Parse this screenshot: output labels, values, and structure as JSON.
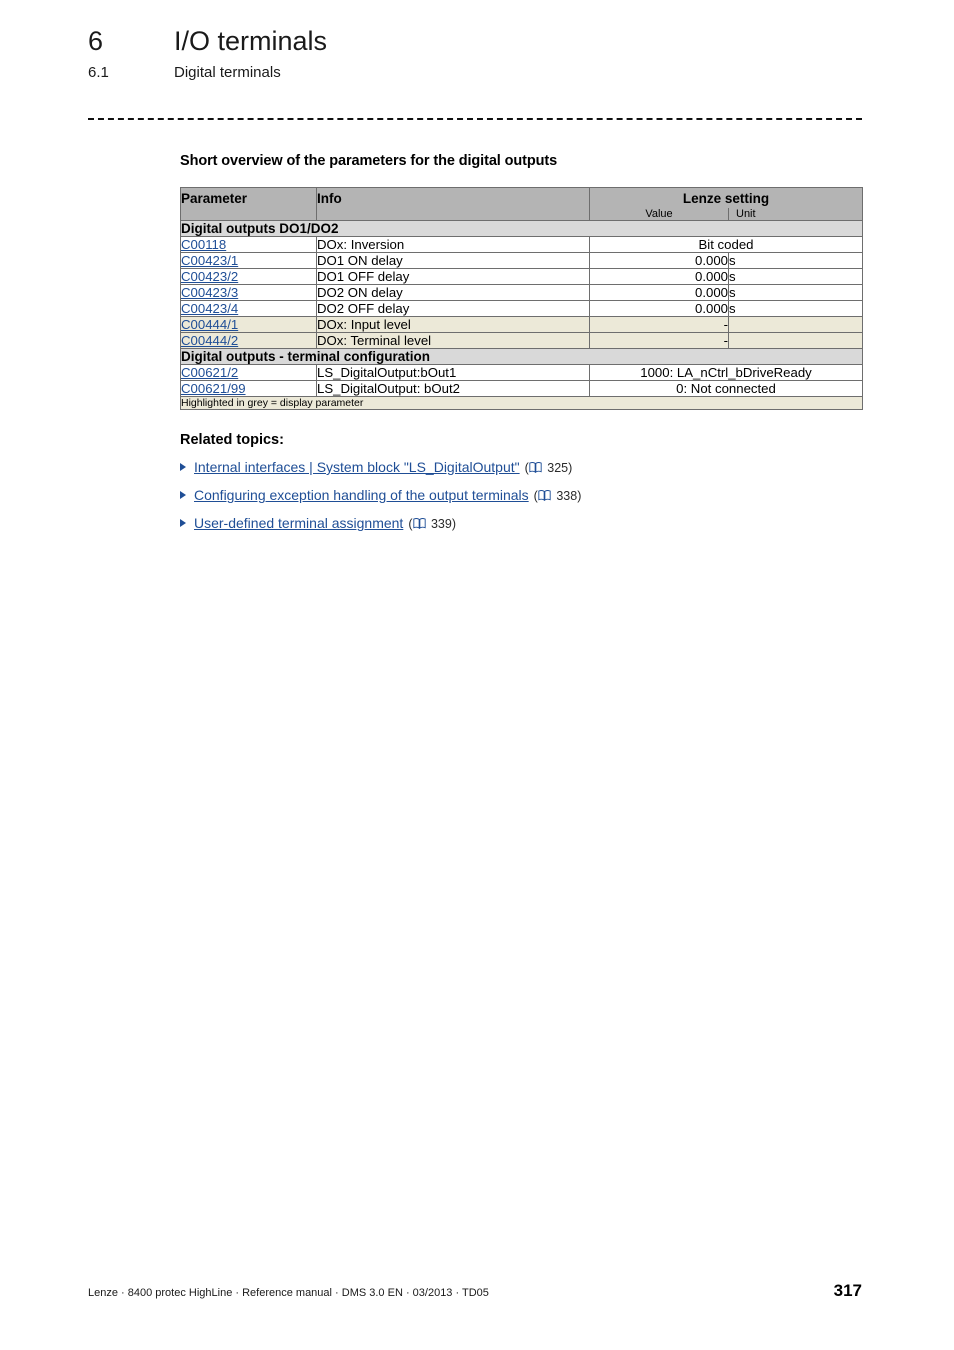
{
  "header": {
    "chapter_number": "6",
    "chapter_title": "I/O terminals",
    "section_number": "6.1",
    "section_title": "Digital terminals"
  },
  "overview_heading": "Short overview of the parameters for the digital outputs",
  "table": {
    "columns": {
      "parameter": "Parameter",
      "info": "Info",
      "lenze_setting": "Lenze setting",
      "value": "Value",
      "unit": "Unit"
    },
    "groups": [
      {
        "title": "Digital outputs DO1/DO2",
        "rows": [
          {
            "parameter": "C00118",
            "info": "DOx: Inversion",
            "value": "Bit coded",
            "unit": "",
            "span": true,
            "highlight": false
          },
          {
            "parameter": "C00423/1",
            "info": "DO1 ON delay",
            "value": "0.000",
            "unit": "s",
            "span": false,
            "highlight": false
          },
          {
            "parameter": "C00423/2",
            "info": "DO1 OFF delay",
            "value": "0.000",
            "unit": "s",
            "span": false,
            "highlight": false
          },
          {
            "parameter": "C00423/3",
            "info": "DO2 ON delay",
            "value": "0.000",
            "unit": "s",
            "span": false,
            "highlight": false
          },
          {
            "parameter": "C00423/4",
            "info": "DO2 OFF delay",
            "value": "0.000",
            "unit": "s",
            "span": false,
            "highlight": false
          },
          {
            "parameter": "C00444/1",
            "info": "DOx: Input level",
            "value": "-",
            "unit": "",
            "span": false,
            "highlight": true
          },
          {
            "parameter": "C00444/2",
            "info": "DOx: Terminal level",
            "value": "-",
            "unit": "",
            "span": false,
            "highlight": true
          }
        ]
      },
      {
        "title": "Digital outputs - terminal configuration",
        "rows": [
          {
            "parameter": "C00621/2",
            "info": "LS_DigitalOutput:bOut1",
            "value": "1000: LA_nCtrl_bDriveReady",
            "unit": "",
            "span": true,
            "highlight": false
          },
          {
            "parameter": "C00621/99",
            "info": "LS_DigitalOutput: bOut2",
            "value": "0: Not connected",
            "unit": "",
            "span": true,
            "highlight": false
          }
        ]
      }
    ],
    "footnote": "Highlighted in grey = display parameter"
  },
  "related": {
    "heading": "Related topics:",
    "items": [
      {
        "label": "Internal interfaces | System block \"LS_DigitalOutput\"",
        "page": "325"
      },
      {
        "label": "Configuring exception handling of the output terminals",
        "page": "338"
      },
      {
        "label": "User-defined terminal assignment",
        "page": "339"
      }
    ]
  },
  "footer": {
    "text": "Lenze · 8400 protec HighLine · Reference manual · DMS 3.0 EN · 03/2013 · TD05",
    "page_number": "317"
  },
  "colors": {
    "link": "#1f4e96",
    "table_header": "#b4b4b4",
    "group_row": "#d9d9d9",
    "highlight_row": "#ece9d8"
  }
}
